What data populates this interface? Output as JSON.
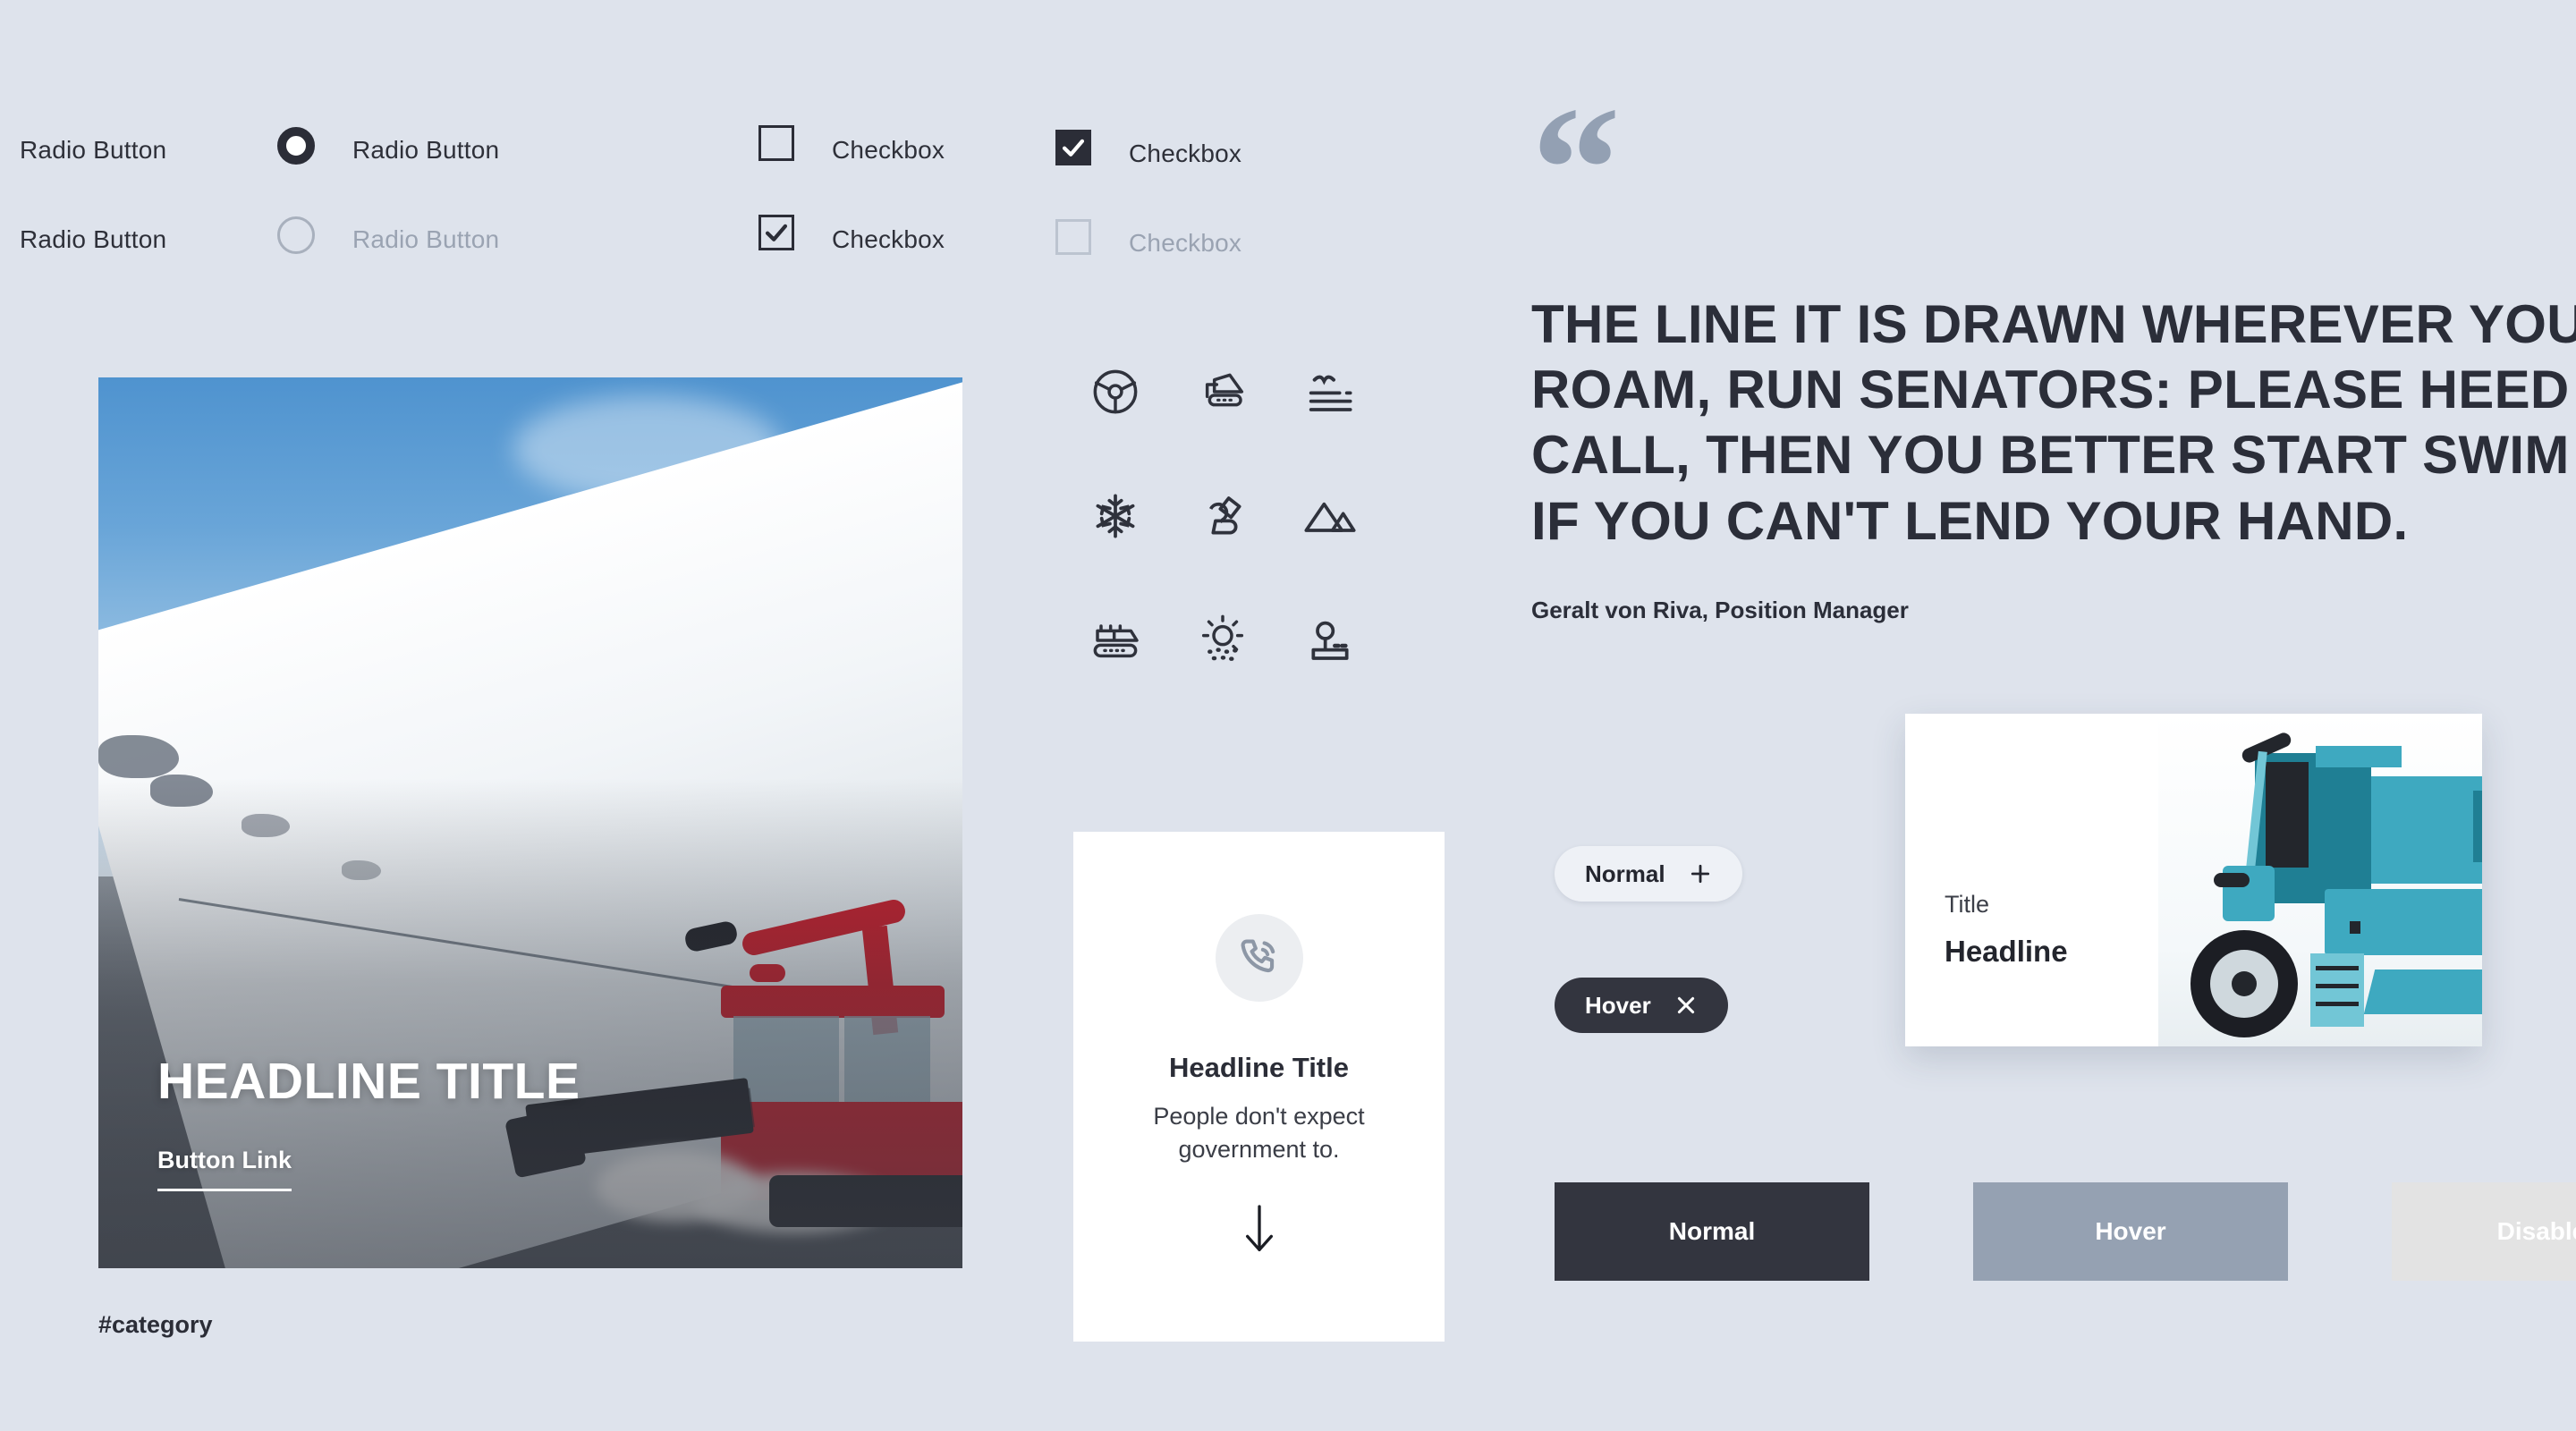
{
  "theme": {
    "background": "#dee3ec",
    "ink": "#2b2d37",
    "muted": "#9aa3b2",
    "accent_dark": "#33353f",
    "hover_gray": "#95a1b2",
    "disabled_gray": "#e3e3e3",
    "quote_mark": "#93a0b3",
    "machine_blue": "#3ea9c0",
    "groomer_red": "#c5202e"
  },
  "controls": {
    "radio_rows": [
      {
        "side_label": "Radio Button",
        "label": "Radio Button",
        "state": "selected"
      },
      {
        "side_label": "Radio Button",
        "label": "Radio Button",
        "state": "disabled"
      }
    ],
    "checkbox_rows": [
      {
        "label": "Checkbox",
        "state": "unchecked"
      },
      {
        "label": "Checkbox",
        "state": "checked-filled"
      },
      {
        "label": "Checkbox",
        "state": "checked-outline"
      },
      {
        "label": "Checkbox",
        "state": "disabled"
      }
    ]
  },
  "icons": {
    "grid": [
      {
        "name": "steering-wheel-icon",
        "label": "Steering Wheel"
      },
      {
        "name": "snow-groomer-icon",
        "label": "Snow Groomer"
      },
      {
        "name": "snow-layers-bird-icon",
        "label": "Snow Layers"
      },
      {
        "name": "snowflake-icon",
        "label": "Snowflake"
      },
      {
        "name": "snow-cannon-icon",
        "label": "Snow Cannon"
      },
      {
        "name": "mountains-icon",
        "label": "Mountains"
      },
      {
        "name": "tracked-vehicle-icon",
        "label": "Tracked Vehicle"
      },
      {
        "name": "sun-snow-icon",
        "label": "Sun with Snow"
      },
      {
        "name": "joystick-icon",
        "label": "Joystick"
      }
    ]
  },
  "hero": {
    "title": "HEADLINE TITLE",
    "link_label": "Button Link",
    "category": "#category",
    "image_alt": "Red snow groomer on a snowy mountain slope under blue sky"
  },
  "info_card": {
    "icon": "phone-signal-icon",
    "title": "Headline Title",
    "body": "People don't expect government to.",
    "arrow_icon": "arrow-down-icon"
  },
  "quote": {
    "mark": "“",
    "text": "THE LINE IT IS DRAWN WHEREVER YOU ROAM, RUN SENATORS: PLEASE HEED CALL, THEN YOU BETTER START SWIM IF YOU CAN'T LEND YOUR HAND.",
    "lines": [
      "THE LINE IT IS DRAWN WHEREVER YOU",
      "ROAM, RUN SENATORS: PLEASE HEED",
      "CALL, THEN YOU BETTER START SWIM",
      "IF YOU CAN'T LEND YOUR HAND."
    ],
    "author": "Geralt von Riva, Position Manager"
  },
  "pills": [
    {
      "label": "Normal",
      "icon": "plus-icon",
      "state": "normal"
    },
    {
      "label": "Hover",
      "icon": "close-icon",
      "state": "hover"
    }
  ],
  "media_card": {
    "title": "Title",
    "headline": "Headline",
    "image_alt": "Teal snow grooming machine"
  },
  "state_buttons": [
    {
      "label": "Normal",
      "state": "normal"
    },
    {
      "label": "Hover",
      "state": "hover"
    },
    {
      "label": "Disabled",
      "state": "disabled"
    }
  ]
}
